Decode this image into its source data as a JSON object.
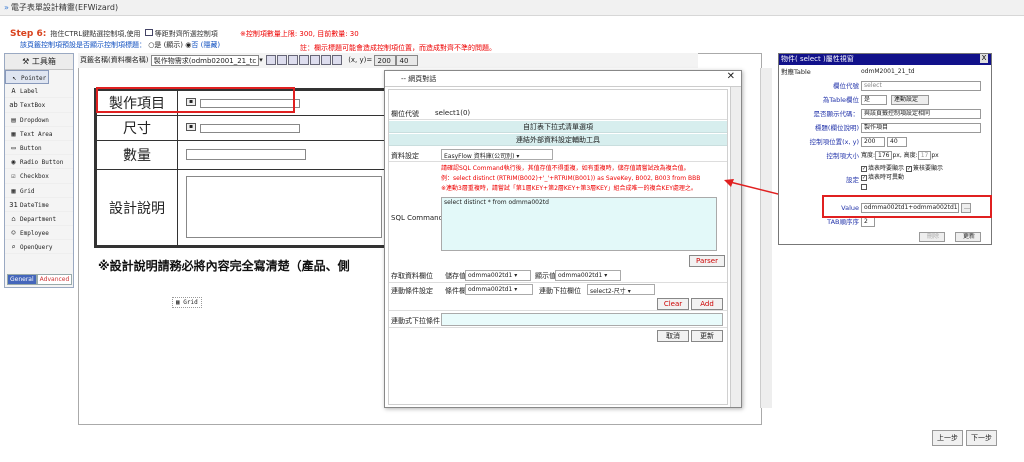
{
  "window_title": "電子表單設計精靈(EFWizard)",
  "step": {
    "label": "Step 6:",
    "text": "拖住CTRL鍵點選控制項,使用",
    "icon_hint": "等距對齊所選控制項",
    "counts": "※控制項數量上限: 300, 目前數量: 30",
    "line2": "該頁籤控制項預設是否顯示控制項標題：",
    "opt_yes": "是 (顯示)",
    "opt_no": "否 (隱藏)",
    "warning": "註：欄示標題可能會造成控制項位置，而造成對齊不準的問題。"
  },
  "toolbox": {
    "title": "工具箱",
    "items": [
      "Pointer",
      "Label",
      "TextBox",
      "Dropdown",
      "Text Area",
      "Button",
      "Radio Button",
      "Checkbox",
      "Grid",
      "DateTime",
      "Department",
      "Employee",
      "OpenQuery"
    ],
    "tab_general": "General",
    "tab_advanced": "Advanced"
  },
  "page_bar": {
    "label": "頁籤名稱(資料欄名稱)",
    "value": "製作物需求(odmb02001_21_tc",
    "coords": "(x, y)=",
    "x": "200",
    "y": "40"
  },
  "form": {
    "r1": "製作項目",
    "r2": "尺寸",
    "r3": "數量",
    "r4": "設計說明",
    "note": "※設計說明請務必將內容完全寫清楚（產品、側",
    "grid_widget": "Grid"
  },
  "nav": {
    "prev": "上一步",
    "next": "下一步"
  },
  "dialog": {
    "title": "-- 網頁對話",
    "field_code_label": "欄位代號",
    "field_code_value": "select1(0)",
    "bar1": "自訂表下拉式清單選項",
    "bar2": "連結外部資料設定輔助工具",
    "ds_label": "資料設定",
    "ds_value": "EasyFlow 資料庫(公司別)",
    "hint1": "請確認SQL Command執行後，其值存值不得重複，如有重複時，儲存值請嘗試改為複合值。",
    "hint2": "例：select distinct (RTRIM(B002)+'_'+RTRIM(B001)) as SaveKey, B002, B003 from BBB",
    "hint3": "※連動3層重複時，請嘗試「第1層KEY+第2層KEY+第3層KEY」組合成唯一的複合KEY處理之。",
    "sql_label": "SQL Command",
    "sql_value": "select distinct * from odmma002td",
    "parser": "Parser",
    "save_label": "存取資料欄位",
    "save_val_label": "儲存值",
    "save_val": "odmma002td1",
    "show_label": "顯示值",
    "show_val": "odmma002td1",
    "link_label": "連動條件設定",
    "cond_label": "條件欄位",
    "cond_val": "odmma002td1",
    "link_dd_label": "連動下拉欄位",
    "link_dd_val": "select2-尺寸",
    "clear": "Clear",
    "add": "Add",
    "linkcond_label": "連動式下拉條件",
    "cancel": "取消",
    "update": "更新"
  },
  "props": {
    "title": "物件( select )屬性視窗",
    "rows": [
      {
        "k": "對應Table",
        "v": "odmM2001_21_td"
      },
      {
        "k": "欄位代號",
        "v": "select"
      },
      {
        "k": "為Table欄位",
        "v": "是"
      },
      {
        "k": "是否顯示代碼：",
        "v": "與該頁籤控制項設定相同"
      },
      {
        "k": "標題(欄位說明)",
        "v": "製作項目"
      },
      {
        "k": "控制項位置(x, y)",
        "v": "200"
      },
      {
        "k": "控制項大小",
        "v": "寬度:"
      }
    ],
    "sync_btn": "連動設定",
    "pos_y": "40",
    "width_val": "176",
    "px1": "px, 高度:",
    "height_val": "17",
    "px2": "px",
    "cb1": "填表時要顯示",
    "cb2": "簽核要顯示",
    "cb3": "填表時可異動",
    "setting_label": "設定",
    "value_label": "Value",
    "value_val": "odmma002td1+odmma002td1",
    "tab_label": "TAB順序序",
    "tab_val": "2",
    "delete": "刪除",
    "update": "更新"
  }
}
